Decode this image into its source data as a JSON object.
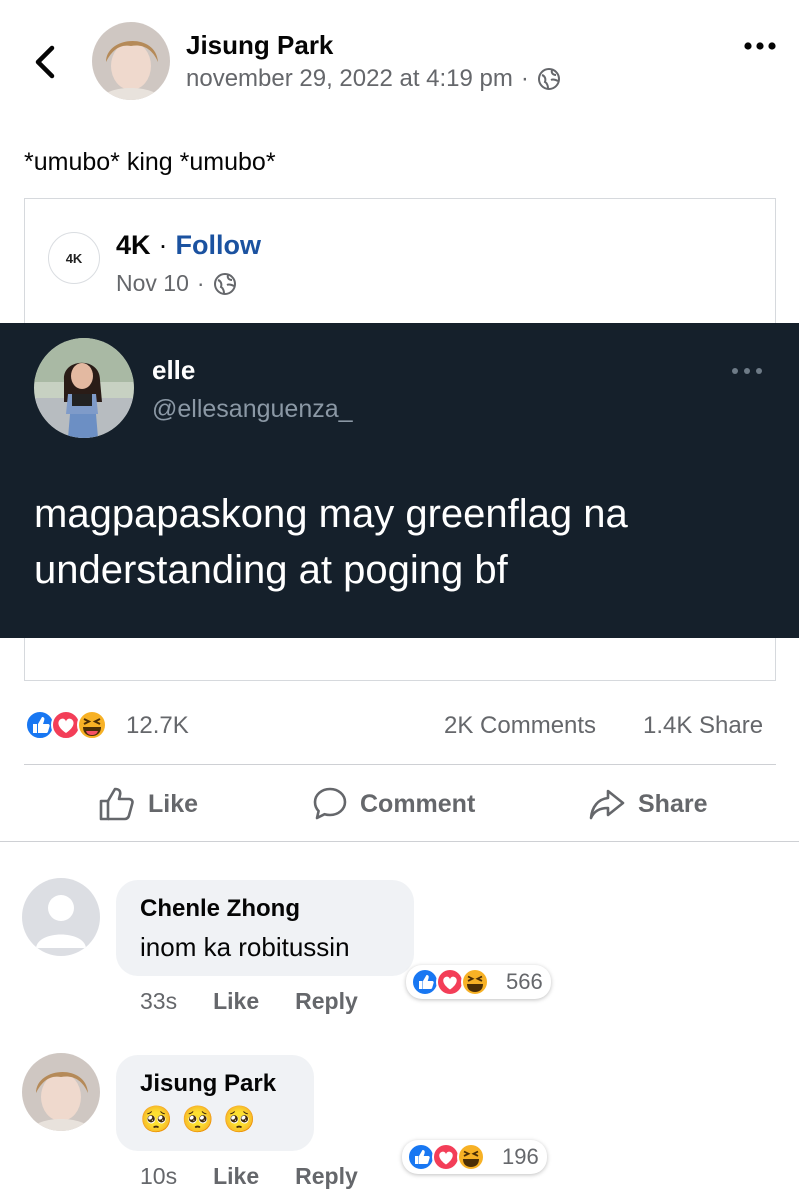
{
  "header": {
    "author_name": "Jisung Park",
    "timestamp": "november 29, 2022 at 4:19 pm",
    "separator": "·",
    "audience_icon": "globe-icon",
    "back_icon": "chevron-left-icon",
    "more_icon": "more-horizontal-icon"
  },
  "post": {
    "text": "*umubo* king *umubo*"
  },
  "shared": {
    "page_logo_text": "4K",
    "page_name": "4K",
    "separator": "·",
    "follow_label": "Follow",
    "date": "Nov 10",
    "date_separator": "·",
    "audience_icon": "globe-icon",
    "tweet": {
      "name": "elle",
      "handle": "@ellesanguenza_",
      "text": "magpapaskong may greenflag na understanding at poging bf",
      "more_icon": "more-horizontal-icon"
    }
  },
  "stats": {
    "reactions": "12.7K",
    "comments": "2K Comments",
    "shares": "1.4K Share"
  },
  "actions": {
    "like": "Like",
    "comment": "Comment",
    "share": "Share"
  },
  "comments": [
    {
      "author": "Chenle Zhong",
      "text": "inom ka robitussin",
      "time": "33s",
      "like_label": "Like",
      "reply_label": "Reply",
      "reactions": "566"
    },
    {
      "author": "Jisung Park",
      "text": "🥺 🥺 🥺",
      "time": "10s",
      "like_label": "Like",
      "reply_label": "Reply",
      "reactions": "196"
    }
  ],
  "colors": {
    "link_blue": "#1b52a0",
    "tweet_bg": "#15202b",
    "secondary_text": "#65676b",
    "like_blue": "#1877f2",
    "love_red": "#f33e58",
    "haha_yellow": "#f7b125"
  }
}
